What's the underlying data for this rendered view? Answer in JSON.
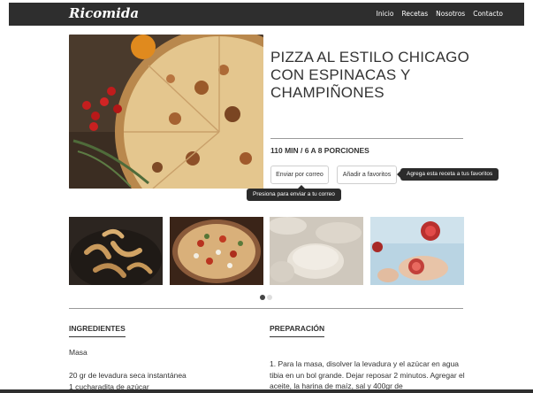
{
  "nav": {
    "brand": "Ricomida",
    "links": [
      "Inicio",
      "Recetas",
      "Nosotros",
      "Contacto"
    ]
  },
  "recipe": {
    "title": "PIZZA AL ESTILO CHICAGO CON ESPINACAS Y CHAMPIÑONES",
    "meta": "110 MIN / 6 A 8 PORCIONES",
    "email_button": "Enviar por correo",
    "favorite_button": "Añadir a favoritos",
    "favorite_tooltip": "Agrega esta receta a tus favoritos",
    "email_tooltip": "Presiona para enviar a tu correo"
  },
  "gallery": {
    "images": [
      "pizza-with-peppers",
      "mushrooms-bowl",
      "pizza-on-tray",
      "dough-balls",
      "pomegranate-hands"
    ],
    "dots": 2,
    "active_dot": 0
  },
  "ingredients": {
    "heading": "INGREDIENTES",
    "group": "Masa",
    "items": [
      "20 gr de levadura seca instantánea",
      "1 cucharadita de azúcar"
    ]
  },
  "preparation": {
    "heading": "PREPARACIÓN",
    "text": "1. Para la masa, disolver la levadura y el azúcar en agua tibia en un bol grande.  Dejar reposar 2 minutos. Agregar el aceite, la harina de maíz, sal y 400gr de"
  },
  "colors": {
    "navbar": "#2e2e2e",
    "tooltip": "#2b2b2b",
    "text": "#333333"
  }
}
